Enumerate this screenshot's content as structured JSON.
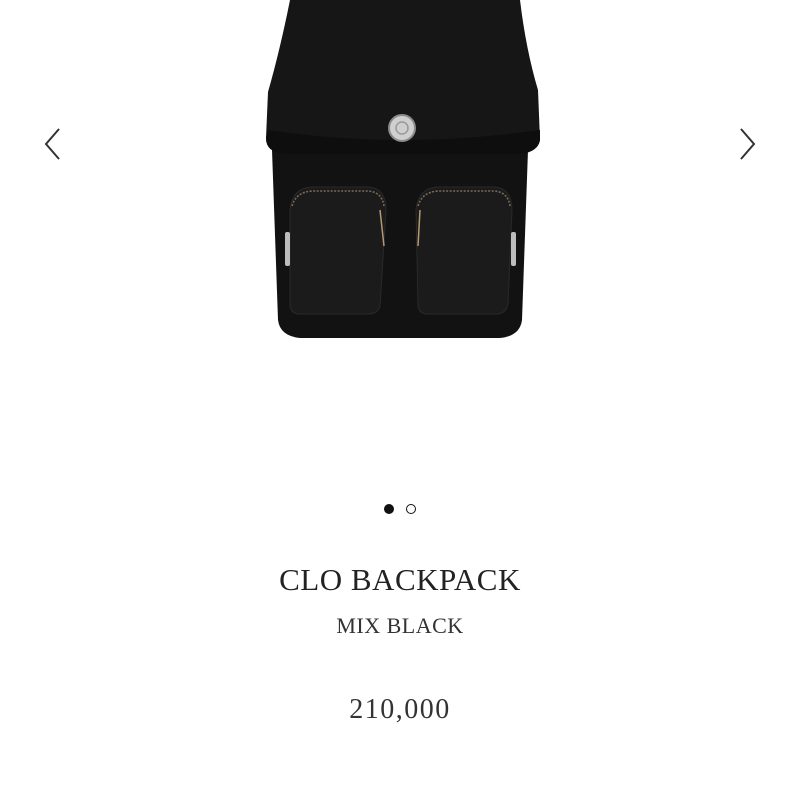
{
  "carousel": {
    "prev_icon": "chevron-left-icon",
    "next_icon": "chevron-right-icon",
    "total_slides": 2,
    "active_slide": 1
  },
  "product": {
    "name": "CLO BACKPACK",
    "color": "MIX BLACK",
    "price": "210,000"
  },
  "colors": {
    "bag": "#141414",
    "text": "#222222"
  }
}
